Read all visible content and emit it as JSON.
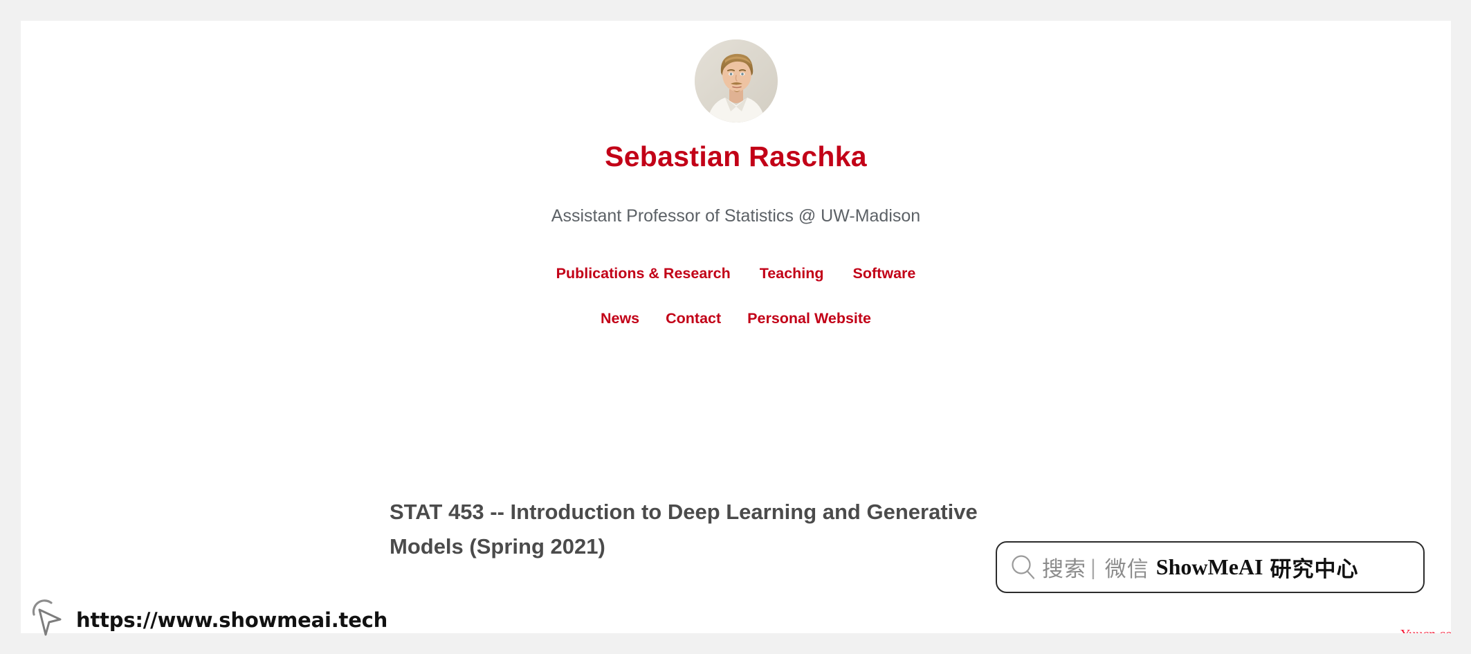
{
  "page": {
    "background_color": "#f1f1f1",
    "card_color": "#ffffff",
    "accent_red": "#c20017",
    "heading_grey": "#4b4b4b",
    "subtitle_grey": "#5c6166"
  },
  "profile": {
    "avatar_icon": "person-avatar-photo",
    "name": "Sebastian Raschka",
    "subtitle": "Assistant Professor of Statistics @ UW-Madison"
  },
  "nav": {
    "row1": [
      {
        "label": "Publications & Research"
      },
      {
        "label": "Teaching"
      },
      {
        "label": "Software"
      }
    ],
    "row2": [
      {
        "label": "News"
      },
      {
        "label": "Contact"
      },
      {
        "label": "Personal Website"
      }
    ]
  },
  "main": {
    "course_title": "STAT 453 -- Introduction to Deep Learning and Generative Models (Spring 2021)"
  },
  "watermark_search_bar": {
    "search_icon": "magnifier-icon",
    "search_label": "搜索",
    "divider": "|",
    "channel_label": "微信",
    "brand_latin": "ShowMeAI",
    "brand_cn": "研究中心"
  },
  "watermark_url": {
    "cursor_icon": "mouse-cursor-icon",
    "url": "https://www.showmeai.tech"
  },
  "credit": {
    "text": "Yuucn.com",
    "color": "#f51431"
  }
}
